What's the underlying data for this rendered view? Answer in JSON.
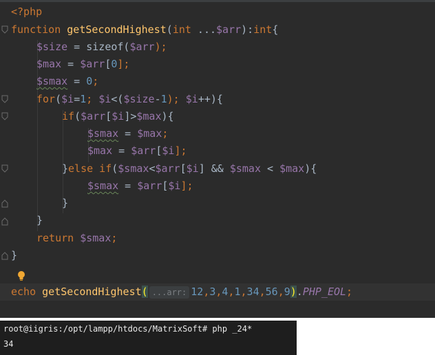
{
  "editor": {
    "lines": [
      {
        "id": "open-tag",
        "tokens": [
          {
            "t": "<?php",
            "c": "kw"
          }
        ]
      },
      {
        "id": "func-decl",
        "tokens": [
          {
            "t": "function ",
            "c": "kw"
          },
          {
            "t": "getSecondHighest",
            "c": "fn"
          },
          {
            "t": "(",
            "c": "txt"
          },
          {
            "t": "int",
            "c": "kw"
          },
          {
            "t": " ...",
            "c": "txt"
          },
          {
            "t": "$arr",
            "c": "var"
          },
          {
            "t": "):",
            "c": "txt"
          },
          {
            "t": "int",
            "c": "kw"
          },
          {
            "t": "{",
            "c": "txt"
          }
        ]
      },
      {
        "id": "size-assign",
        "tokens": [
          {
            "t": "$size",
            "c": "var"
          },
          {
            "t": " = sizeof(",
            "c": "txt"
          },
          {
            "t": "$arr",
            "c": "var"
          },
          {
            "t": ");",
            "c": "kw"
          }
        ]
      },
      {
        "id": "max-assign",
        "tokens": [
          {
            "t": "$max",
            "c": "var"
          },
          {
            "t": " = ",
            "c": "txt"
          },
          {
            "t": "$arr",
            "c": "var"
          },
          {
            "t": "[",
            "c": "txt"
          },
          {
            "t": "0",
            "c": "num"
          },
          {
            "t": "];",
            "c": "kw"
          }
        ]
      },
      {
        "id": "smax-assign",
        "tokens": [
          {
            "t": "$smax",
            "c": "var ul"
          },
          {
            "t": " = ",
            "c": "txt"
          },
          {
            "t": "0",
            "c": "num"
          },
          {
            "t": ";",
            "c": "kw"
          }
        ]
      },
      {
        "id": "for-loop",
        "tokens": [
          {
            "t": "for",
            "c": "kw"
          },
          {
            "t": "(",
            "c": "txt"
          },
          {
            "t": "$i",
            "c": "var"
          },
          {
            "t": "=",
            "c": "txt"
          },
          {
            "t": "1",
            "c": "num"
          },
          {
            "t": "; ",
            "c": "kw"
          },
          {
            "t": "$i",
            "c": "var"
          },
          {
            "t": "<(",
            "c": "txt"
          },
          {
            "t": "$size",
            "c": "var"
          },
          {
            "t": "-",
            "c": "txt"
          },
          {
            "t": "1",
            "c": "num"
          },
          {
            "t": "); ",
            "c": "kw"
          },
          {
            "t": "$i",
            "c": "var"
          },
          {
            "t": "++){",
            "c": "txt"
          }
        ]
      },
      {
        "id": "if-cond",
        "tokens": [
          {
            "t": "if",
            "c": "kw"
          },
          {
            "t": "(",
            "c": "txt"
          },
          {
            "t": "$arr",
            "c": "var"
          },
          {
            "t": "[",
            "c": "txt"
          },
          {
            "t": "$i",
            "c": "var"
          },
          {
            "t": "]>",
            "c": "txt"
          },
          {
            "t": "$max",
            "c": "var"
          },
          {
            "t": "){",
            "c": "txt"
          }
        ]
      },
      {
        "id": "smax-eq-max",
        "tokens": [
          {
            "t": "$smax",
            "c": "var ul"
          },
          {
            "t": " = ",
            "c": "txt"
          },
          {
            "t": "$max",
            "c": "var"
          },
          {
            "t": ";",
            "c": "kw"
          }
        ]
      },
      {
        "id": "max-eq-arr",
        "tokens": [
          {
            "t": "$max",
            "c": "var"
          },
          {
            "t": " = ",
            "c": "txt"
          },
          {
            "t": "$arr",
            "c": "var"
          },
          {
            "t": "[",
            "c": "txt"
          },
          {
            "t": "$i",
            "c": "var"
          },
          {
            "t": "];",
            "c": "kw"
          }
        ]
      },
      {
        "id": "else-if",
        "tokens": [
          {
            "t": "}",
            "c": "txt"
          },
          {
            "t": "else if",
            "c": "kw"
          },
          {
            "t": "(",
            "c": "txt"
          },
          {
            "t": "$smax",
            "c": "var"
          },
          {
            "t": "<",
            "c": "txt"
          },
          {
            "t": "$arr",
            "c": "var"
          },
          {
            "t": "[",
            "c": "txt"
          },
          {
            "t": "$i",
            "c": "var"
          },
          {
            "t": "] && ",
            "c": "txt"
          },
          {
            "t": "$smax",
            "c": "var"
          },
          {
            "t": " < ",
            "c": "txt"
          },
          {
            "t": "$max",
            "c": "var"
          },
          {
            "t": "){",
            "c": "txt"
          }
        ]
      },
      {
        "id": "smax-eq-arr",
        "tokens": [
          {
            "t": "$smax",
            "c": "var ul"
          },
          {
            "t": " = ",
            "c": "txt"
          },
          {
            "t": "$arr",
            "c": "var"
          },
          {
            "t": "[",
            "c": "txt"
          },
          {
            "t": "$i",
            "c": "var"
          },
          {
            "t": "];",
            "c": "kw"
          }
        ]
      },
      {
        "id": "close-if",
        "tokens": [
          {
            "t": "}",
            "c": "txt"
          }
        ]
      },
      {
        "id": "close-for",
        "tokens": [
          {
            "t": "}",
            "c": "txt"
          }
        ]
      },
      {
        "id": "return-stmt",
        "tokens": [
          {
            "t": "return ",
            "c": "kw"
          },
          {
            "t": "$smax",
            "c": "var"
          },
          {
            "t": ";",
            "c": "kw"
          }
        ]
      },
      {
        "id": "close-func",
        "tokens": [
          {
            "t": "}",
            "c": "txt"
          }
        ]
      },
      {
        "id": "blank",
        "tokens": []
      },
      {
        "id": "echo-call",
        "tokens": [
          {
            "t": "echo ",
            "c": "kw"
          },
          {
            "t": "getSecondHighest",
            "c": "fn"
          },
          {
            "t": "(",
            "c": "paren-hl"
          },
          {
            "hint": "...arr:"
          },
          {
            "t": "12",
            "c": "num"
          },
          {
            "t": ",",
            "c": "kw"
          },
          {
            "t": "3",
            "c": "num"
          },
          {
            "t": ",",
            "c": "kw"
          },
          {
            "t": "4",
            "c": "num"
          },
          {
            "t": ",",
            "c": "kw"
          },
          {
            "t": "1",
            "c": "num"
          },
          {
            "t": ",",
            "c": "kw"
          },
          {
            "t": "34",
            "c": "num"
          },
          {
            "t": ",",
            "c": "kw"
          },
          {
            "t": "56",
            "c": "num"
          },
          {
            "t": ",",
            "c": "kw"
          },
          {
            "t": "9",
            "c": "num"
          },
          {
            "t": ")",
            "c": "paren-hl"
          },
          {
            "t": ".",
            "c": "txt"
          },
          {
            "t": "PHP_EOL",
            "c": "cst"
          },
          {
            "t": ";",
            "c": "kw"
          }
        ]
      }
    ]
  },
  "terminal": {
    "prompt_line": "root@iigris:/opt/lampp/htdocs/MatrixSoft# php _24*",
    "output_line": "34"
  },
  "colors": {
    "editor_bg": "#2b2b2b",
    "keyword": "#cc7832",
    "function": "#ffc66d",
    "variable": "#9876aa",
    "number": "#6897bb",
    "text": "#a9b7c6",
    "terminal_bg": "#1e1e1e"
  },
  "icons": {
    "intention": "lightbulb-icon",
    "fold": "fold-marker-icon"
  }
}
